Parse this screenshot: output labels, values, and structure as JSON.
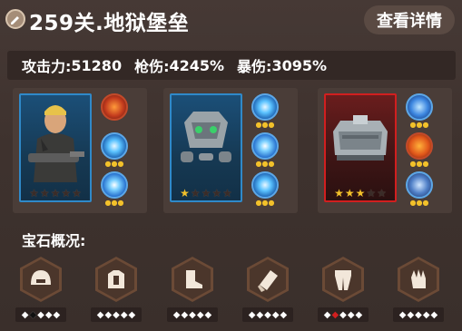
{
  "header": {
    "title": "259关.地狱堡垒",
    "details_button": "查看详情"
  },
  "stats": {
    "attack_label": "攻击力:",
    "attack_value": "51280",
    "gun_damage_label": "枪伤:",
    "gun_damage_value": "4245%",
    "crit_damage_label": "暴伤:",
    "crit_damage_value": "3095%"
  },
  "heroes": [
    {
      "name": "soldier",
      "stars": 0,
      "frame_color": "#2f89c9",
      "skills": [
        {
          "icon": "fire-slash-icon",
          "dots": 0
        },
        {
          "icon": "ice-shard-icon",
          "dots": 3
        },
        {
          "icon": "lightning-icon",
          "dots": 3
        }
      ]
    },
    {
      "name": "mech-drone",
      "stars": 1,
      "frame_color": "#2f89c9",
      "skills": [
        {
          "icon": "ice-burst-icon",
          "dots": 3
        },
        {
          "icon": "lightning-icon",
          "dots": 3
        },
        {
          "icon": "ice-shard-icon",
          "dots": 3
        }
      ]
    },
    {
      "name": "armored-tank",
      "stars": 3,
      "frame_color": "#d11f1f",
      "skills": [
        {
          "icon": "crossed-swords-icon",
          "dots": 3
        },
        {
          "icon": "pumpkin-icon",
          "dots": 3
        },
        {
          "icon": "shield-icon",
          "dots": 3
        }
      ]
    }
  ],
  "gems": {
    "label": "宝石概况:",
    "items": [
      {
        "slot": "helmet",
        "icon": "helmet-icon",
        "states": [
          "white",
          "dark",
          "white",
          "white",
          "white"
        ]
      },
      {
        "slot": "armor",
        "icon": "armor-icon",
        "states": [
          "white",
          "white",
          "white",
          "white",
          "white"
        ]
      },
      {
        "slot": "boots",
        "icon": "boot-icon",
        "states": [
          "white",
          "white",
          "white",
          "white",
          "white"
        ]
      },
      {
        "slot": "gauntlet",
        "icon": "gauntlet-icon",
        "states": [
          "white",
          "white",
          "white",
          "white",
          "white"
        ]
      },
      {
        "slot": "legs",
        "icon": "leg-armor-icon",
        "states": [
          "white",
          "red",
          "white",
          "white",
          "white"
        ]
      },
      {
        "slot": "gloves",
        "icon": "glove-icon",
        "states": [
          "white",
          "white",
          "white",
          "white",
          "white"
        ]
      }
    ]
  },
  "colors": {
    "background": "#3e322e",
    "star_gold": "#f3c12a",
    "blue_frame": "#2f89c9",
    "red_frame": "#d11f1f"
  }
}
